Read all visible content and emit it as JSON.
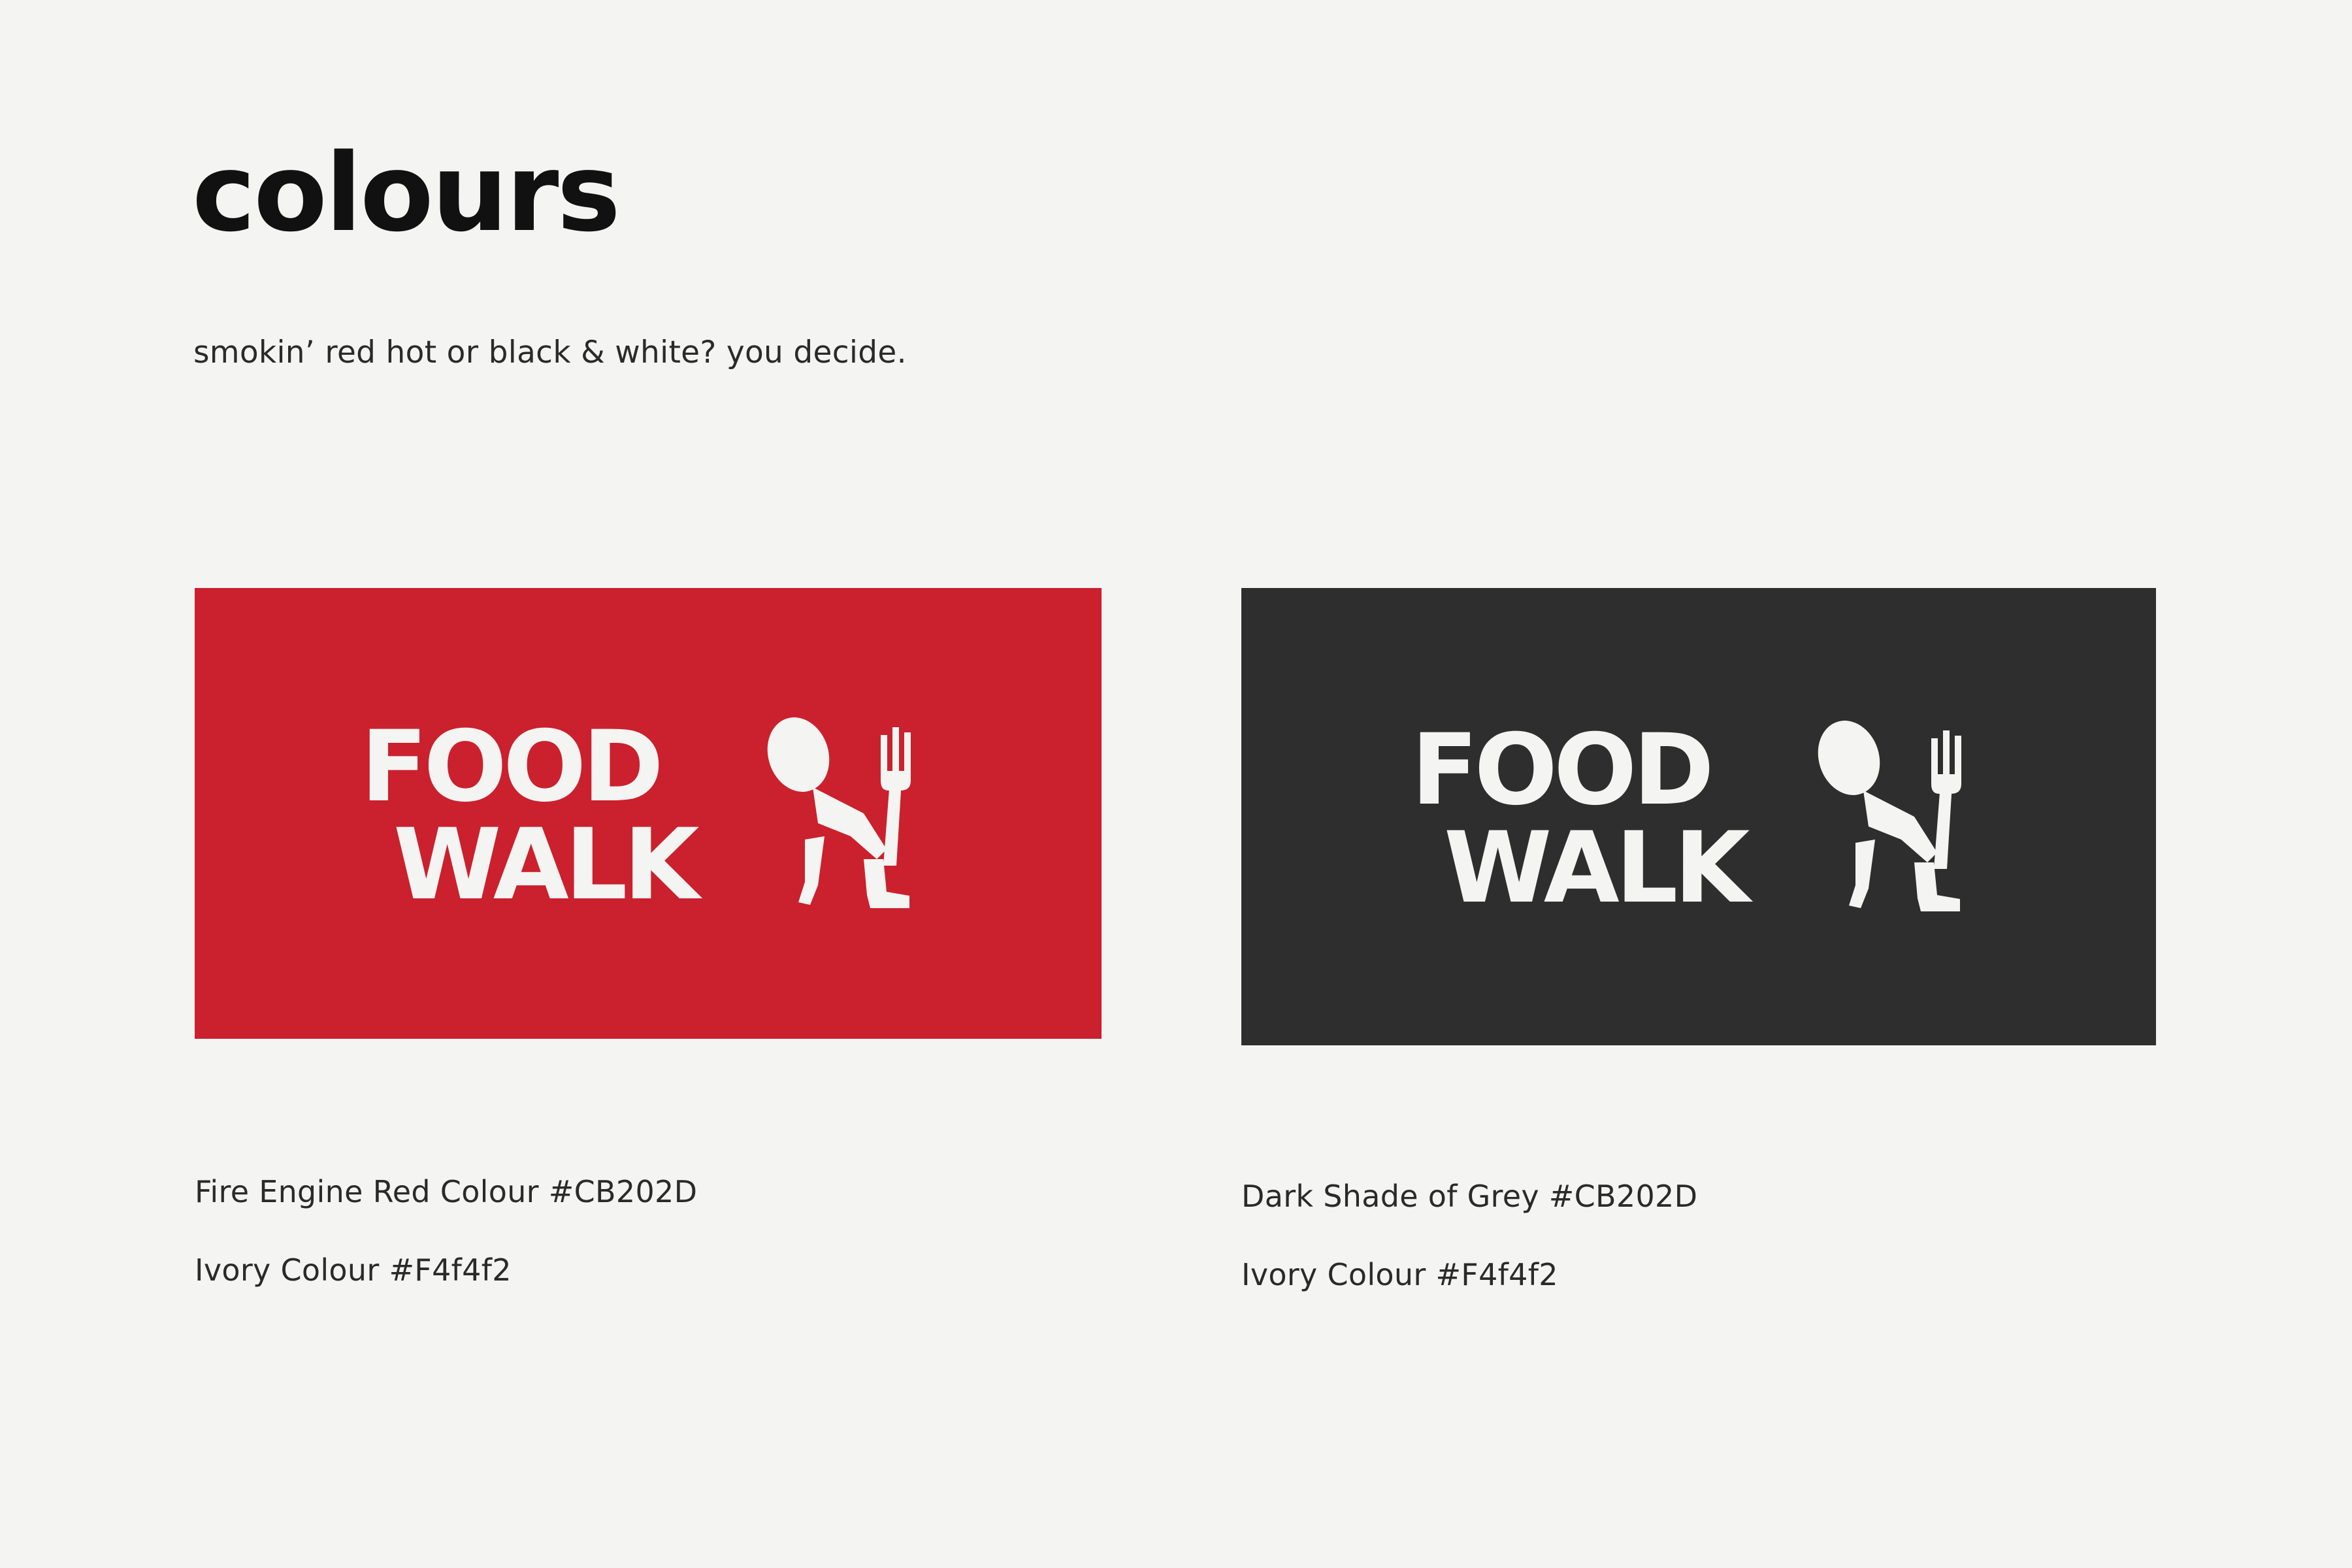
{
  "page": {
    "title": "colours",
    "subtitle": "smokin’ red hot or black & white? you decide.",
    "background_color": "#f4f4f2"
  },
  "swatches": [
    {
      "color": "#CB202D",
      "logo": {
        "line1": "FOOD",
        "line2": "WALK",
        "icon": "walking-spoon-fork-mascot"
      },
      "captions": [
        "Fire Engine Red Colour #CB202D",
        "Ivory Colour #F4f4f2"
      ]
    },
    {
      "color": "#2e2e2e",
      "logo": {
        "line1": "FOOD",
        "line2": "WALK",
        "icon": "walking-spoon-fork-mascot"
      },
      "captions": [
        "Dark Shade of Grey #CB202D",
        "Ivory Colour #F4f4f2"
      ]
    }
  ],
  "logo_color": "#f4f4f2"
}
